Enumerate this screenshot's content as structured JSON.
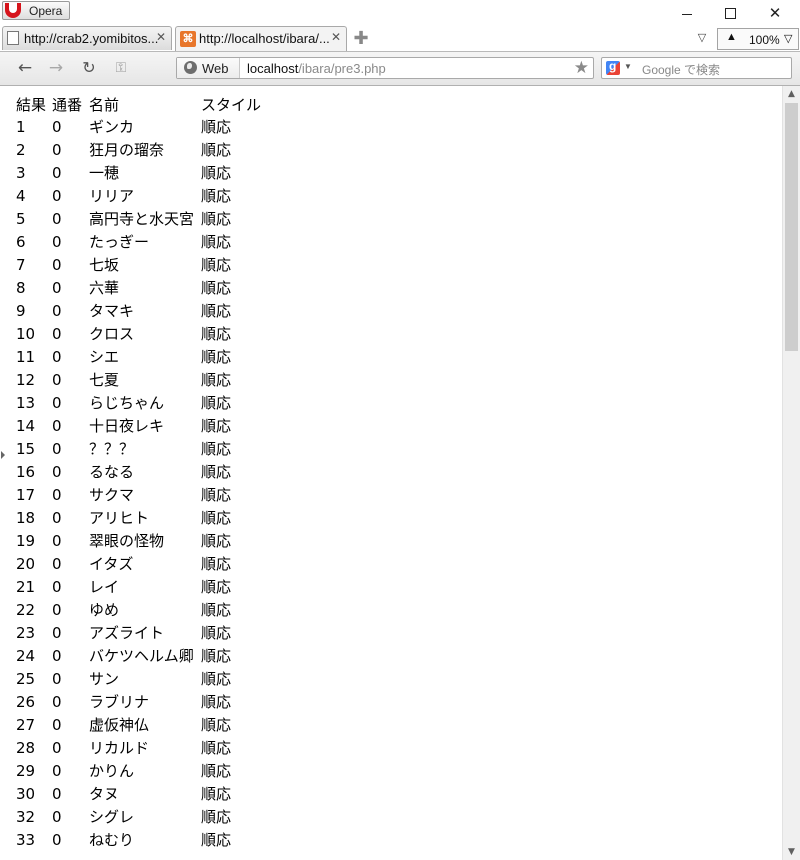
{
  "browser": {
    "menu_label": "Opera",
    "window_controls": {
      "minimize": "",
      "maximize": "",
      "close": "✕"
    },
    "tabs": [
      {
        "title": "http://crab2.yomibitos...",
        "close": "✕"
      },
      {
        "title": "http://localhost/ibara/...",
        "close": "✕"
      }
    ],
    "new_tab_glyph": "✚",
    "tab_list_glyph": "▽",
    "zoom": {
      "up": "▲",
      "value": "100%",
      "down": "▽"
    },
    "nav": {
      "back": "←",
      "forward": "→",
      "reload": "↻",
      "key": "⚿"
    },
    "address": {
      "badge": "Web",
      "host": "localhost",
      "path": "/ibara/pre3.php",
      "star": "★"
    },
    "search": {
      "engine_icon": "google-icon",
      "placeholder": "Google で検索"
    },
    "scrollbar": {
      "up": "▲",
      "down": "▼"
    }
  },
  "page": {
    "headers": [
      "結果",
      "通番",
      "名前",
      "スタイル"
    ],
    "rows": [
      {
        "result": "1",
        "serial": "0",
        "name": "ギンカ",
        "style": "順応"
      },
      {
        "result": "2",
        "serial": "0",
        "name": "狂月の瑠奈",
        "style": "順応"
      },
      {
        "result": "3",
        "serial": "0",
        "name": "一穂",
        "style": "順応"
      },
      {
        "result": "4",
        "serial": "0",
        "name": "リリア",
        "style": "順応"
      },
      {
        "result": "5",
        "serial": "0",
        "name": "高円寺と水天宮",
        "style": "順応"
      },
      {
        "result": "6",
        "serial": "0",
        "name": "たっぎー",
        "style": "順応"
      },
      {
        "result": "7",
        "serial": "0",
        "name": "七坂",
        "style": "順応"
      },
      {
        "result": "8",
        "serial": "0",
        "name": "六華",
        "style": "順応"
      },
      {
        "result": "9",
        "serial": "0",
        "name": "タマキ",
        "style": "順応"
      },
      {
        "result": "10",
        "serial": "0",
        "name": "クロス",
        "style": "順応"
      },
      {
        "result": "11",
        "serial": "0",
        "name": "シエ",
        "style": "順応"
      },
      {
        "result": "12",
        "serial": "0",
        "name": "七夏",
        "style": "順応"
      },
      {
        "result": "13",
        "serial": "0",
        "name": "らじちゃん",
        "style": "順応"
      },
      {
        "result": "14",
        "serial": "0",
        "name": "十日夜レキ",
        "style": "順応"
      },
      {
        "result": "15",
        "serial": "0",
        "name": "？？？",
        "style": "順応"
      },
      {
        "result": "16",
        "serial": "0",
        "name": "るなる",
        "style": "順応"
      },
      {
        "result": "17",
        "serial": "0",
        "name": "サクマ",
        "style": "順応"
      },
      {
        "result": "18",
        "serial": "0",
        "name": "アリヒト",
        "style": "順応"
      },
      {
        "result": "19",
        "serial": "0",
        "name": "翠眼の怪物",
        "style": "順応"
      },
      {
        "result": "20",
        "serial": "0",
        "name": "イタズ",
        "style": "順応"
      },
      {
        "result": "21",
        "serial": "0",
        "name": "レイ",
        "style": "順応"
      },
      {
        "result": "22",
        "serial": "0",
        "name": "ゆめ",
        "style": "順応"
      },
      {
        "result": "23",
        "serial": "0",
        "name": "アズライト",
        "style": "順応"
      },
      {
        "result": "24",
        "serial": "0",
        "name": "バケツヘルム卿",
        "style": "順応"
      },
      {
        "result": "25",
        "serial": "0",
        "name": "サン",
        "style": "順応"
      },
      {
        "result": "26",
        "serial": "0",
        "name": "ラブリナ",
        "style": "順応"
      },
      {
        "result": "27",
        "serial": "0",
        "name": "虚仮神仏",
        "style": "順応"
      },
      {
        "result": "28",
        "serial": "0",
        "name": "リカルド",
        "style": "順応"
      },
      {
        "result": "29",
        "serial": "0",
        "name": "かりん",
        "style": "順応"
      },
      {
        "result": "30",
        "serial": "0",
        "name": "タヌ",
        "style": "順応"
      },
      {
        "result": "32",
        "serial": "0",
        "name": "シグレ",
        "style": "順応"
      },
      {
        "result": "33",
        "serial": "0",
        "name": "ねむり",
        "style": "順応"
      }
    ]
  }
}
